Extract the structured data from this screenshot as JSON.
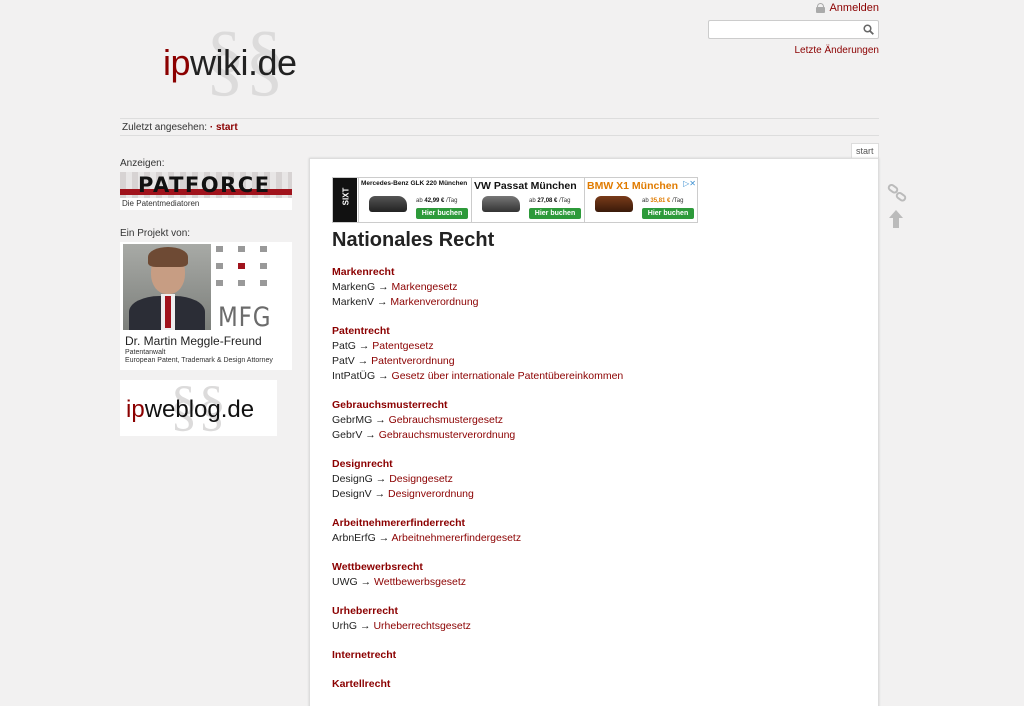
{
  "header": {
    "login_label": "Anmelden",
    "search_placeholder": "",
    "recent_changes": "Letzte Änderungen",
    "logo_ip": "ip",
    "logo_rest": "wiki.de",
    "logo_symbol": "§§"
  },
  "breadcrumbs": {
    "label": "Zuletzt angesehen:",
    "separator": "·",
    "current": "start"
  },
  "sidebar": {
    "ads_label": "Anzeigen:",
    "patforce_word": "PATFORCE",
    "patforce_sub": "Die Patentmediatoren",
    "project_label": "Ein Projekt von:",
    "mfg": "MFG",
    "person_name": "Dr. Martin Meggle-Freund",
    "person_title_1": "Patentanwalt",
    "person_title_2": "European Patent, Trademark & Design Attorney",
    "ipweblog_ip": "ip",
    "ipweblog_rest": "weblog.de",
    "ipweblog_symbol": "§§"
  },
  "page_tab": "start",
  "ad": {
    "brand": "SIXT",
    "items": [
      {
        "title": "Mercedes-Benz GLK 220 München",
        "price_prefix": "ab",
        "price": "42,99 €",
        "price_suffix": "/Tag",
        "button": "Hier buchen"
      },
      {
        "title": "VW Passat München",
        "price_prefix": "ab",
        "price": "27,08 €",
        "price_suffix": "/Tag",
        "button": "Hier buchen"
      },
      {
        "title": "BMW X1 München",
        "price_prefix": "ab",
        "price": "35,81 €",
        "price_suffix": "/Tag",
        "button": "Hier buchen"
      }
    ],
    "adchoices": "▷✕"
  },
  "content": {
    "title": "Nationales Recht",
    "arrow": "→",
    "sections": [
      {
        "title": "Markenrecht",
        "entries": [
          {
            "abbr": "MarkenG",
            "law": "Markengesetz"
          },
          {
            "abbr": "MarkenV",
            "law": "Markenverordnung"
          }
        ]
      },
      {
        "title": "Patentrecht",
        "entries": [
          {
            "abbr": "PatG",
            "law": "Patentgesetz"
          },
          {
            "abbr": "PatV",
            "law": "Patentverordnung"
          },
          {
            "abbr": "IntPatÜG",
            "law": "Gesetz über internationale Patentübereinkommen"
          }
        ]
      },
      {
        "title": "Gebrauchsmusterrecht",
        "entries": [
          {
            "abbr": "GebrMG",
            "law": "Gebrauchsmustergesetz"
          },
          {
            "abbr": "GebrV",
            "law": "Gebrauchsmusterverordnung"
          }
        ]
      },
      {
        "title": "Designrecht",
        "entries": [
          {
            "abbr": "DesignG",
            "law": "Designgesetz"
          },
          {
            "abbr": "DesignV",
            "law": "Designverordnung"
          }
        ]
      },
      {
        "title": "Arbeitnehmererfinderrecht",
        "entries": [
          {
            "abbr": "ArbnErfG",
            "law": "Arbeitnehmererfindergesetz"
          }
        ]
      },
      {
        "title": "Wettbewerbsrecht",
        "entries": [
          {
            "abbr": "UWG",
            "law": "Wettbewerbsgesetz"
          }
        ]
      },
      {
        "title": "Urheberrecht",
        "entries": [
          {
            "abbr": "UrhG",
            "law": "Urheberrechtsgesetz"
          }
        ]
      },
      {
        "title": "Internetrecht",
        "entries": []
      },
      {
        "title": "Kartellrecht",
        "entries": []
      }
    ]
  },
  "colors": {
    "accent": "#8b0000",
    "background": "#f2f1f1",
    "ad_button": "#2d9a3a"
  }
}
